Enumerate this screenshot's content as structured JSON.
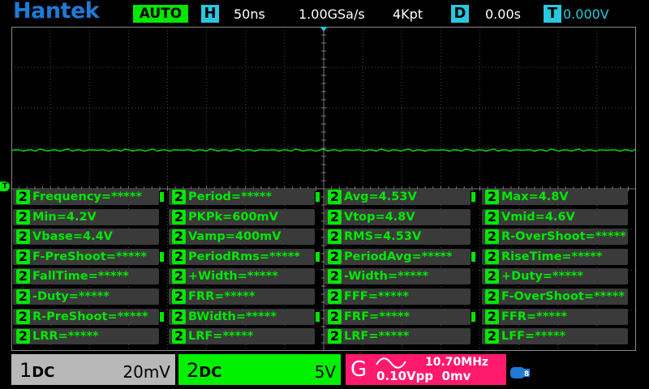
{
  "header": {
    "brand": "Hantek",
    "mode": "AUTO",
    "horizontal": {
      "badge": "H",
      "timebase": "50ns",
      "sample_rate": "1.00GSa/s",
      "memory_depth": "4Kpt"
    },
    "delay": {
      "badge": "D",
      "value": "0.00s"
    },
    "trigger": {
      "badge": "T",
      "value": "0.000V"
    }
  },
  "channel_marker_label": "T",
  "measurements": [
    [
      "Frequency=*****",
      "Period=*****",
      "Avg=4.53V",
      "Max=4.8V"
    ],
    [
      "Min=4.2V",
      "PKPk=600mV",
      "Vtop=4.8V",
      "Vmid=4.6V"
    ],
    [
      "Vbase=4.4V",
      "Vamp=400mV",
      "RMS=4.53V",
      "R-OverShoot=*****"
    ],
    [
      "F-PreShoot=*****",
      "PeriodRms=*****",
      "PeriodAvg=*****",
      "RiseTime=*****"
    ],
    [
      "FallTime=*****",
      "+Width=*****",
      "-Width=*****",
      "+Duty=*****"
    ],
    [
      "-Duty=*****",
      "FRR=*****",
      "FFF=*****",
      "F-OverShoot=*****"
    ],
    [
      "R-PreShoot=*****",
      "BWidth=*****",
      "FRF=*****",
      "FFR=*****"
    ],
    [
      "LRR=*****",
      "LRF=*****",
      "LRF=*****",
      "LFF=*****"
    ]
  ],
  "measurement_channel": "2",
  "bottom": {
    "ch1": {
      "name": "1",
      "coupling": "DC",
      "scale": "20mV"
    },
    "ch2": {
      "name": "2",
      "coupling": "DC",
      "scale": "5V"
    },
    "trigger": {
      "label": "G",
      "frequency": "10.70MHz",
      "amplitude": "0.10Vpp",
      "level": "0mv"
    }
  },
  "colors": {
    "ch2": "#00e800",
    "brand": "#1e7bd6",
    "cyan": "#28c8e0",
    "trigger_bg": "#ff1a6e"
  }
}
